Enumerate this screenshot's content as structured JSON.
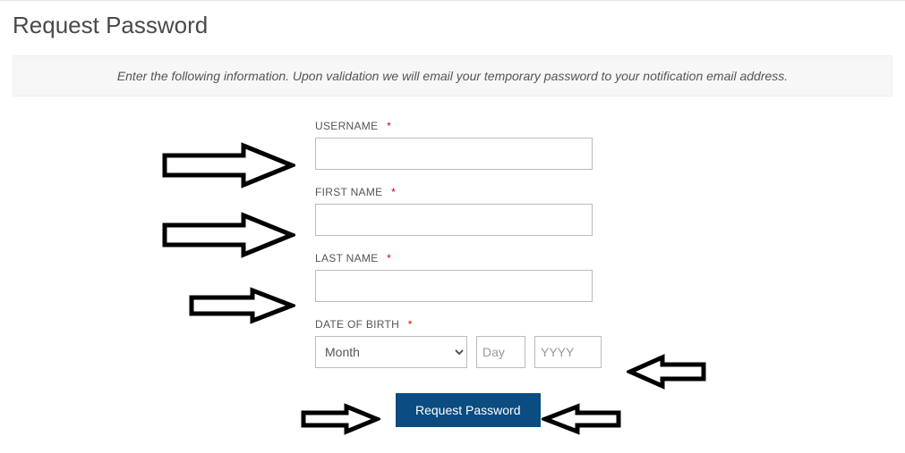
{
  "page": {
    "title": "Request Password",
    "info": "Enter the following information. Upon validation we will email your temporary password to your notification email address."
  },
  "form": {
    "username_label": "USERNAME",
    "firstname_label": "FIRST NAME",
    "lastname_label": "LAST NAME",
    "dob_label": "DATE OF BIRTH",
    "required_marker": "*",
    "month_placeholder": "Month",
    "day_placeholder": "Day",
    "year_placeholder": "YYYY",
    "submit_label": "Request Password"
  }
}
